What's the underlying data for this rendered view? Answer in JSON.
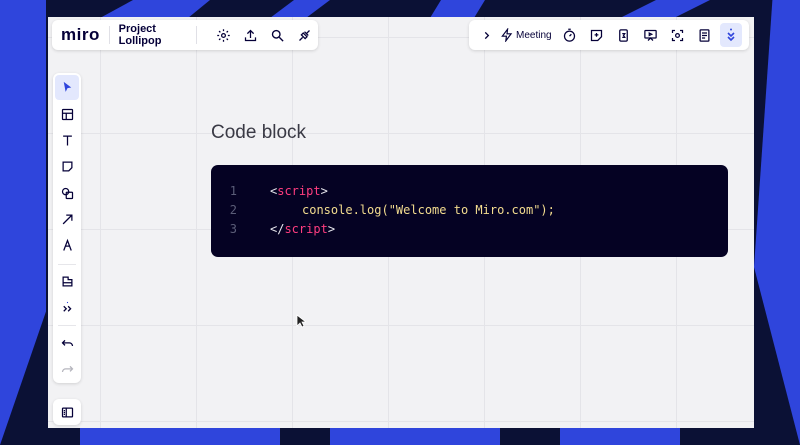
{
  "app": {
    "logo": "miro",
    "board_name": "Project Lollipop"
  },
  "header_right": {
    "meeting_label": "Meeting"
  },
  "icons": {
    "header_left": [
      "gear-icon",
      "upload-icon",
      "search-icon",
      "plug-icon"
    ],
    "header_right": [
      "chevron-right-icon",
      "lightning-icon",
      "timer-icon",
      "sticky-note-icon",
      "counter-icon",
      "presentation-icon",
      "focus-icon",
      "notes-icon",
      "expand-icon"
    ],
    "toolbar": [
      "cursor-icon",
      "templates-icon",
      "text-icon",
      "sticky-note-icon",
      "shapes-icon",
      "arrow-icon",
      "pen-icon",
      "frame-icon",
      "more-icon",
      "undo-icon",
      "redo-icon"
    ],
    "bottom": [
      "panel-icon"
    ]
  },
  "code_block": {
    "title": "Code block",
    "lines": [
      {
        "num": "1",
        "open": "<",
        "tag": "script",
        "close": ">",
        "code": ""
      },
      {
        "num": "2",
        "code": "console.log(\"Welcome to Miro.com\");"
      },
      {
        "num": "3",
        "open": "</",
        "tag": "script",
        "close": ">",
        "code": ""
      }
    ]
  },
  "colors": {
    "brand_blue": "#2f45dc",
    "code_bg": "#050223",
    "code_tag": "#ff3d7f",
    "code_text": "#f3dc8f",
    "active_tool_bg": "#e3e8fd"
  }
}
